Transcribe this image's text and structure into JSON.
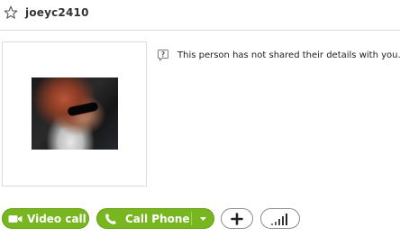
{
  "header": {
    "username": "joeyc2410",
    "favorite_icon": "star-outline-icon"
  },
  "profile": {
    "photo_description_icon": "profile-photo",
    "info_icon": "question-bubble-icon",
    "info_text": "This person has not shared their details with you."
  },
  "actions": {
    "video_call_label": "Video call",
    "video_icon": "video-camera-icon",
    "call_phone_label": "Call Phone",
    "phone_icon": "phone-handset-icon",
    "dropdown_icon": "chevron-down-icon",
    "add_icon": "plus-icon",
    "quality_icon": "signal-bars-icon"
  },
  "colors": {
    "accent_green": "#77b61f",
    "green_border": "#63a012",
    "divider": "#d9d9d9"
  }
}
